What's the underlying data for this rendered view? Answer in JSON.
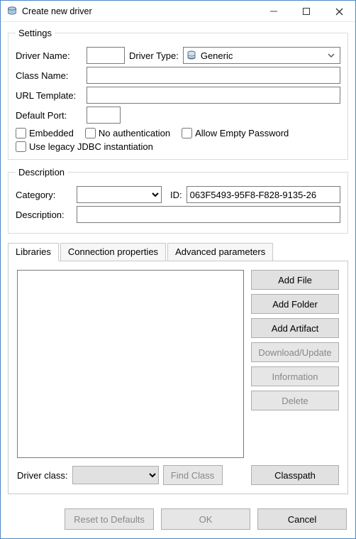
{
  "window": {
    "title": "Create new driver"
  },
  "settings": {
    "legend": "Settings",
    "driver_name_label": "Driver Name:",
    "driver_name_value": "",
    "driver_type_label": "Driver Type:",
    "driver_type_value": "Generic",
    "class_name_label": "Class Name:",
    "class_name_value": "",
    "url_template_label": "URL Template:",
    "url_template_value": "",
    "default_port_label": "Default Port:",
    "default_port_value": "",
    "embedded_label": "Embedded",
    "no_auth_label": "No authentication",
    "allow_empty_pw_label": "Allow Empty Password",
    "legacy_jdbc_label": "Use legacy JDBC instantiation"
  },
  "description": {
    "legend": "Description",
    "category_label": "Category:",
    "category_value": "",
    "id_label": "ID:",
    "id_value": "063F5493-95F8-F828-9135-26",
    "description_label": "Description:",
    "description_value": ""
  },
  "tabs": {
    "libraries": "Libraries",
    "conn_props": "Connection properties",
    "adv_params": "Advanced parameters"
  },
  "libs": {
    "add_file": "Add File",
    "add_folder": "Add Folder",
    "add_artifact": "Add Artifact",
    "download_update": "Download/Update",
    "information": "Information",
    "delete": "Delete",
    "classpath": "Classpath",
    "driver_class_label": "Driver class:",
    "driver_class_value": "",
    "find_class": "Find Class"
  },
  "footer": {
    "reset": "Reset to Defaults",
    "ok": "OK",
    "cancel": "Cancel"
  }
}
